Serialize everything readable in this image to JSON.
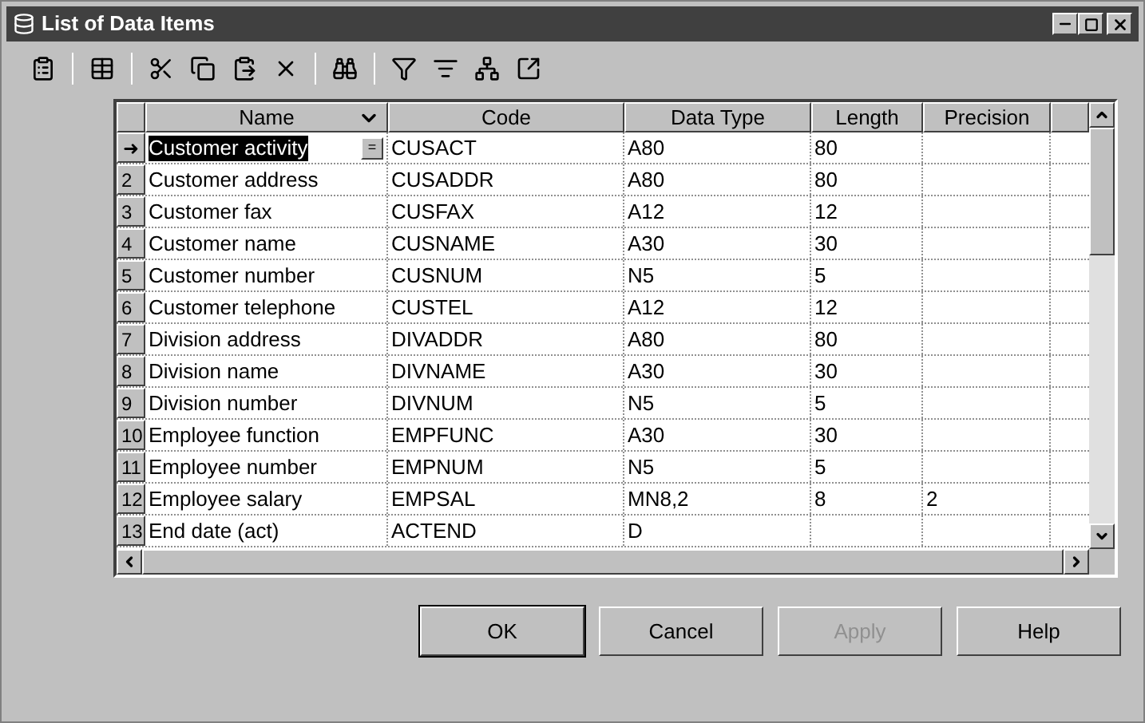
{
  "window": {
    "title": "List of Data Items"
  },
  "table": {
    "columns": [
      {
        "label": "Name",
        "sort": true
      },
      {
        "label": "Code",
        "sort": false
      },
      {
        "label": "Data Type",
        "sort": false
      },
      {
        "label": "Length",
        "sort": false
      },
      {
        "label": "Precision",
        "sort": false
      }
    ],
    "rows": [
      {
        "header": "➜",
        "selected": true,
        "edit": "=",
        "cells": [
          "Customer activity",
          "CUSACT",
          "A80",
          "80",
          ""
        ]
      },
      {
        "header": "2",
        "selected": false,
        "cells": [
          "Customer address",
          "CUSADDR",
          "A80",
          "80",
          ""
        ]
      },
      {
        "header": "3",
        "selected": false,
        "cells": [
          "Customer fax",
          "CUSFAX",
          "A12",
          "12",
          ""
        ]
      },
      {
        "header": "4",
        "selected": false,
        "cells": [
          "Customer name",
          "CUSNAME",
          "A30",
          "30",
          ""
        ]
      },
      {
        "header": "5",
        "selected": false,
        "cells": [
          "Customer number",
          "CUSNUM",
          "N5",
          "5",
          ""
        ]
      },
      {
        "header": "6",
        "selected": false,
        "cells": [
          "Customer telephone",
          "CUSTEL",
          "A12",
          "12",
          ""
        ]
      },
      {
        "header": "7",
        "selected": false,
        "cells": [
          "Division address",
          "DIVADDR",
          "A80",
          "80",
          ""
        ]
      },
      {
        "header": "8",
        "selected": false,
        "cells": [
          "Division name",
          "DIVNAME",
          "A30",
          "30",
          ""
        ]
      },
      {
        "header": "9",
        "selected": false,
        "cells": [
          "Division number",
          "DIVNUM",
          "N5",
          "5",
          ""
        ]
      },
      {
        "header": "10",
        "selected": false,
        "cells": [
          "Employee function",
          "EMPFUNC",
          "A30",
          "30",
          ""
        ]
      },
      {
        "header": "11",
        "selected": false,
        "cells": [
          "Employee number",
          "EMPNUM",
          "N5",
          "5",
          ""
        ]
      },
      {
        "header": "12",
        "selected": false,
        "cells": [
          "Employee salary",
          "EMPSAL",
          "MN8,2",
          "8",
          "2"
        ]
      },
      {
        "header": "13",
        "selected": false,
        "cells": [
          "End date (act)",
          "ACTEND",
          "D",
          "",
          ""
        ]
      }
    ]
  },
  "buttons": [
    {
      "label": "OK",
      "disabled": false,
      "default": true
    },
    {
      "label": "Cancel",
      "disabled": false,
      "default": false
    },
    {
      "label": "Apply",
      "disabled": true,
      "default": false
    },
    {
      "label": "Help",
      "disabled": false,
      "default": false
    }
  ]
}
